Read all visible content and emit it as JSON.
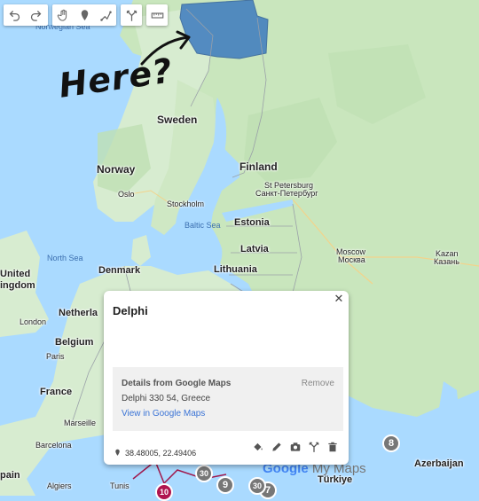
{
  "map": {
    "countries": {
      "sweden": "Sweden",
      "norway": "Norway",
      "finland": "Finland",
      "estonia": "Estonia",
      "latvia": "Latvia",
      "lithuania": "Lithuania",
      "denmark": "Denmark",
      "netherlands": "Netherla",
      "belgium": "Belgium",
      "france": "France",
      "united_kingdom_1": "United",
      "united_kingdom_2": "ingdom",
      "azerbaijan": "Azerbaijan",
      "turkiye": "Türkiye",
      "spain": "pain",
      "tunisia": "Tunis",
      "algeria": "Algiers"
    },
    "cities": {
      "oslo": "Oslo",
      "stockholm": "Stockholm",
      "st_petersburg_en": "St Petersburg",
      "st_petersburg_ru": "Санкт-Петербург",
      "moscow_en": "Moscow",
      "moscow_ru": "Москва",
      "kazan_en": "Kazan",
      "kazan_ru": "Казань",
      "london": "London",
      "paris": "Paris",
      "marseille": "Marseille",
      "barcelona": "Barcelona"
    },
    "seas": {
      "norwegian_sea": "Norwegian Sea",
      "north_sea": "North Sea",
      "baltic_sea": "Baltic Sea"
    },
    "annotation": "Here?",
    "highlight_color": "#3d7bbf",
    "land_color": "#d7ecd0",
    "forest_color": "#b9dcae",
    "water_color": "#aadaff"
  },
  "toolbar": {
    "buttons": [
      "undo-icon",
      "redo-icon",
      "hand-icon",
      "marker-icon",
      "draw-line-icon",
      "directions-icon",
      "ruler-icon"
    ]
  },
  "info_card": {
    "title": "Delphi",
    "details_heading": "Details from Google Maps",
    "remove_label": "Remove",
    "address": "Delphi 330 54, Greece",
    "link_label": "View in Google Maps",
    "coordinates": "38.48005, 22.49406",
    "actions": [
      "paint-bucket-icon",
      "edit-icon",
      "camera-icon",
      "directions-icon",
      "delete-icon"
    ]
  },
  "clusters": {
    "c1": "8",
    "c2": "9",
    "c3": "30",
    "c4": "10",
    "c5": "7",
    "c6": "30"
  },
  "branding": {
    "logo_google": "Google",
    "logo_mymaps": "My Maps"
  }
}
